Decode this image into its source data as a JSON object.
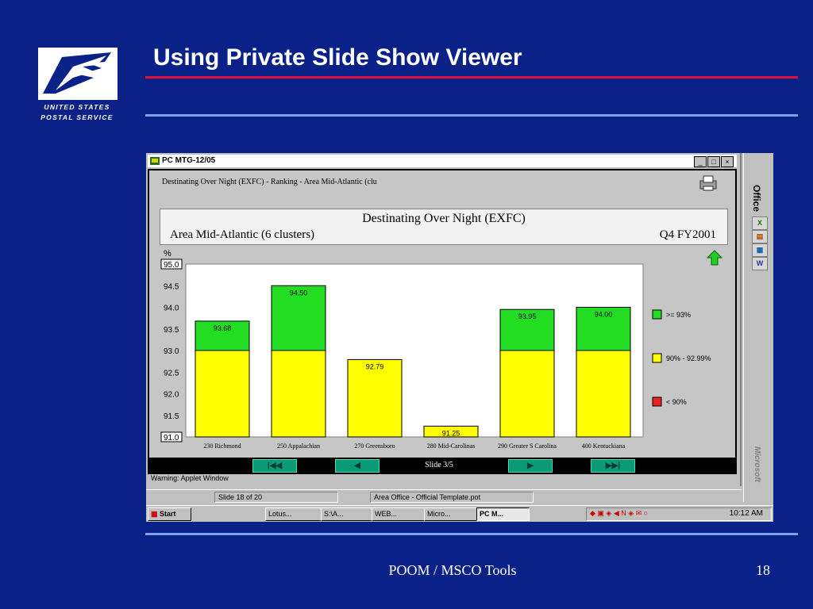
{
  "slide": {
    "title": "Using Private Slide Show Viewer",
    "logo_line1": "UNITED STATES",
    "logo_line2": "POSTAL SERVICE",
    "footer": "POOM / MSCO Tools",
    "page_number": "18"
  },
  "window": {
    "title": "PC MTG-12/05",
    "controls": [
      "_",
      "□",
      "×"
    ],
    "app_header": "Destinating Over Night (EXFC) - Ranking - Area Mid-Atlantic (clu",
    "applet_status": "Warning: Applet Window"
  },
  "chart_header": {
    "title": "Destinating Over Night (EXFC)",
    "subtitle": "Area Mid-Atlantic (6 clusters)",
    "period": "Q4 FY2001"
  },
  "chart_data": {
    "type": "bar",
    "title": "Destinating Over Night (EXFC)",
    "ylabel": "%",
    "ylim": [
      91.0,
      95.0
    ],
    "yticks": [
      "95.0",
      "94.5",
      "94.0",
      "93.5",
      "93.0",
      "92.5",
      "92.0",
      "91.5",
      "91.0"
    ],
    "categories": [
      "230 Richmond",
      "250 Appalachian",
      "270 Greensboro",
      "280 Mid-Carolinas",
      "290 Greater S Carolina",
      "400 Kentuckiana"
    ],
    "values": [
      93.68,
      94.5,
      92.79,
      91.25,
      93.95,
      94.0
    ],
    "data_labels": [
      "93.68",
      "94.50",
      "92.79",
      "91.25",
      "93.95",
      "94.00"
    ],
    "legend": [
      {
        "label": ">= 93%",
        "color": "#22dd22"
      },
      {
        "label": "90% - 92.99%",
        "color": "#ffff00"
      },
      {
        "label": "< 90%",
        "color": "#ee2222"
      }
    ],
    "threshold": 93.0,
    "legend_placement": "right"
  },
  "nav": {
    "first": "|◀◀",
    "prev": "◀",
    "label": "Slide 3/5",
    "next": "▶",
    "last": "▶▶|"
  },
  "office_bar": {
    "label": "Office",
    "brand": "Microsoft",
    "buttons": [
      "X",
      "▤",
      "▦",
      "W"
    ]
  },
  "ppt_status": {
    "slide": "Slide 18 of 20",
    "template": "Area Office - Official Template.pot"
  },
  "taskbar": {
    "start": "Start",
    "items": [
      "Lotus...",
      "S:\\A...",
      "WEB...",
      "Micro...",
      "PC M..."
    ],
    "time": "10:12 AM"
  },
  "colors": {
    "slide_bg": "#0a2287",
    "red_rule": "#e0103a",
    "blue_rule": "#7ea4e8",
    "green": "#22dd22",
    "yellow": "#ffff00",
    "red": "#ee2222"
  }
}
